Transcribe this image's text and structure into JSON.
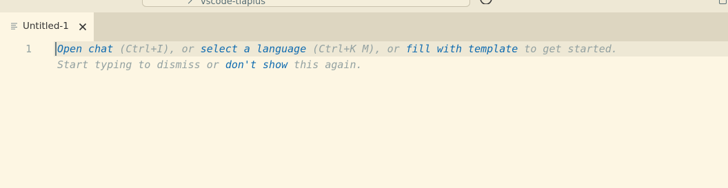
{
  "titlebar": {
    "command_center_text": "vscode-tiaplus",
    "icons": [
      "chevron-left-icon",
      "copilot-icon",
      "layout-icon"
    ]
  },
  "tab": {
    "label": "Untitled-1",
    "icon": "file-lines-icon",
    "close_icon": "close-icon"
  },
  "editor": {
    "line_number": "1",
    "hint": {
      "open_chat": "Open chat",
      "open_chat_shortcut": " (Ctrl+I), or ",
      "select_language": "select a language",
      "select_language_shortcut": " (Ctrl+K M), or ",
      "fill_template": "fill with template",
      "get_started": " to get started.",
      "start_typing": "Start typing to dismiss or ",
      "dont_show": "don't show",
      "this_again": " this again."
    }
  },
  "colors": {
    "background": "#FDF6E3",
    "tabbar": "#DDD6C1",
    "line_highlight": "#EEE8D5",
    "link": "#0F6BB0",
    "hint_text": "#93A1A1"
  }
}
